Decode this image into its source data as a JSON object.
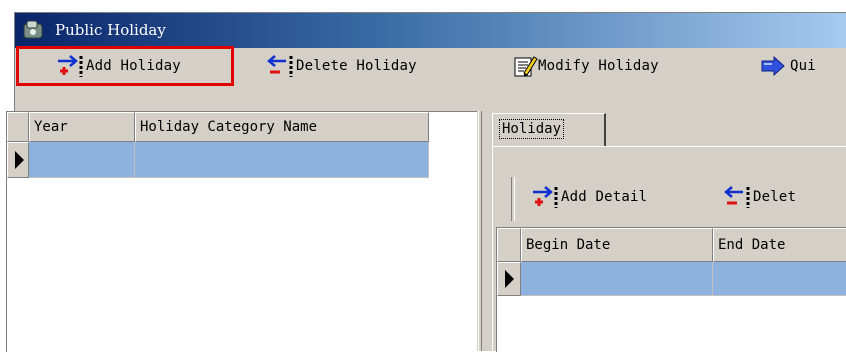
{
  "window": {
    "title": "Public Holiday",
    "icon": "app-icon"
  },
  "toolbar": {
    "buttons": [
      {
        "label": "Add Holiday",
        "icon": "add-icon"
      },
      {
        "label": "Delete Holiday",
        "icon": "delete-icon"
      },
      {
        "label": "Modify Holiday",
        "icon": "modify-icon"
      },
      {
        "label": "Qui",
        "icon": "quick-icon"
      }
    ]
  },
  "holiday_grid": {
    "columns": [
      "Year",
      "Holiday Category Name"
    ],
    "rows": [
      {
        "year": "",
        "category_name": ""
      }
    ],
    "selected_row_color": "#8eb2de"
  },
  "detail": {
    "tab_label": "Holiday",
    "toolbar": {
      "buttons": [
        {
          "label": "Add Detail",
          "icon": "add-icon"
        },
        {
          "label": "Delet",
          "icon": "delete-icon"
        }
      ]
    },
    "grid": {
      "columns": [
        "Begin Date",
        "End Date"
      ],
      "rows": [
        {
          "begin_date": "",
          "end_date": ""
        }
      ]
    }
  },
  "colors": {
    "title_start": "#0a246a",
    "title_end": "#a6caf0",
    "highlight": "#e00000",
    "face": "#d4d0c8"
  }
}
